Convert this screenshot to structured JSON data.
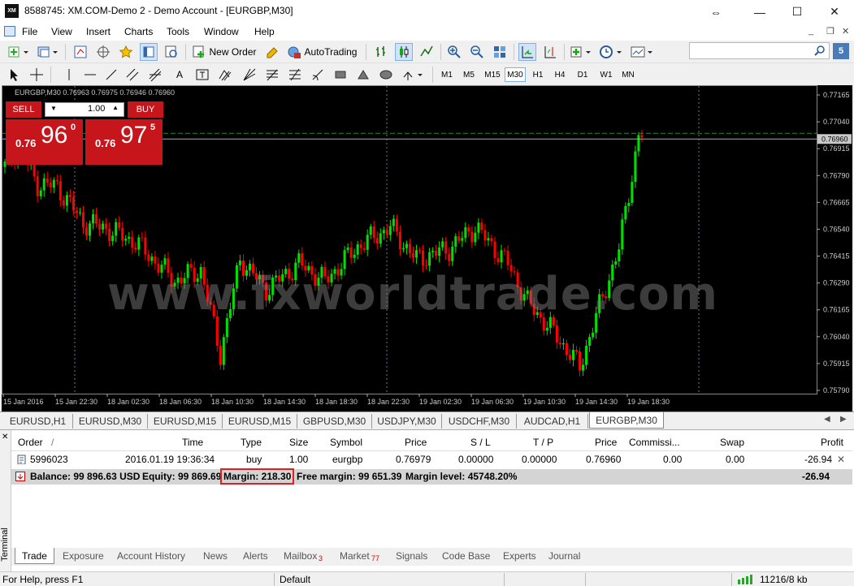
{
  "window": {
    "title": "8588745: XM.COM-Demo 2 - Demo Account - [EURGBP,M30]",
    "logo": "XM"
  },
  "menu": [
    "File",
    "View",
    "Insert",
    "Charts",
    "Tools",
    "Window",
    "Help"
  ],
  "toolbar": {
    "new_order": "New Order",
    "autotrading": "AutoTrading",
    "search_placeholder": ""
  },
  "timeframes": [
    "M1",
    "M5",
    "M15",
    "M30",
    "H1",
    "H4",
    "D1",
    "W1",
    "MN"
  ],
  "active_timeframe": "M30",
  "chart": {
    "info": "EURGBP,M30  0.76963 0.76975 0.76946 0.76960",
    "watermark": "www.fxworldtrade.com",
    "price_labels": [
      "0.77165",
      "0.77040",
      "0.76960",
      "0.76915",
      "0.76790",
      "0.76665",
      "0.76540",
      "0.76415",
      "0.76290",
      "0.76165",
      "0.76040",
      "0.75915",
      "0.75790"
    ],
    "current_price": "0.76960",
    "time_labels": [
      "15 Jan 2016",
      "15 Jan 22:30",
      "18 Jan 02:30",
      "18 Jan 06:30",
      "18 Jan 10:30",
      "18 Jan 14:30",
      "18 Jan 18:30",
      "18 Jan 22:30",
      "19 Jan 02:30",
      "19 Jan 06:30",
      "19 Jan 10:30",
      "19 Jan 14:30",
      "19 Jan 18:30"
    ],
    "colors": {
      "bull": "#00e000",
      "bear": "#ff0000",
      "background": "#000000",
      "grid": "#6a7a8a"
    }
  },
  "one_click": {
    "sell_label": "SELL",
    "buy_label": "BUY",
    "lot": "1.00",
    "sell_prefix": "0.76",
    "sell_big": "96",
    "sell_sup": "0",
    "buy_prefix": "0.76",
    "buy_big": "97",
    "buy_sup": "5"
  },
  "chart_tabs": [
    "EURUSD,H1",
    "EURUSD,M30",
    "EURUSD,M15",
    "EURUSD,M15",
    "GBPUSD,M30",
    "USDJPY,M30",
    "USDCHF,M30",
    "AUDCAD,H1",
    "EURGBP,M30"
  ],
  "active_chart_tab": "EURGBP,M30",
  "terminal": {
    "side_label": "Terminal",
    "headers": {
      "order": "Order",
      "sort": "/",
      "time": "Time",
      "type": "Type",
      "size": "Size",
      "symbol": "Symbol",
      "price": "Price",
      "sl": "S / L",
      "tp": "T / P",
      "price2": "Price",
      "commission": "Commissi...",
      "swap": "Swap",
      "profit": "Profit"
    },
    "row": {
      "order": "5996023",
      "time": "2016.01.19 19:36:34",
      "type": "buy",
      "size": "1.00",
      "symbol": "eurgbp",
      "price": "0.76979",
      "sl": "0.00000",
      "tp": "0.00000",
      "price2": "0.76960",
      "commission": "0.00",
      "swap": "0.00",
      "profit": "-26.94"
    },
    "balance": {
      "balance": "Balance: 99 896.63 USD",
      "equity": "Equity: 99 869.69",
      "margin": "Margin: 218.30",
      "free_margin": "Free margin: 99 651.39",
      "margin_level": "Margin level: 45748.20%",
      "profit": "-26.94"
    },
    "tabs": [
      {
        "label": "Trade"
      },
      {
        "label": "Exposure"
      },
      {
        "label": "Account History"
      },
      {
        "label": "News"
      },
      {
        "label": "Alerts"
      },
      {
        "label": "Mailbox",
        "badge": "3"
      },
      {
        "label": "Market",
        "badge": "77"
      },
      {
        "label": "Signals"
      },
      {
        "label": "Code Base"
      },
      {
        "label": "Experts"
      },
      {
        "label": "Journal"
      }
    ]
  },
  "status": {
    "help": "For Help, press F1",
    "profile": "Default",
    "traffic": "11216/8 kb"
  }
}
